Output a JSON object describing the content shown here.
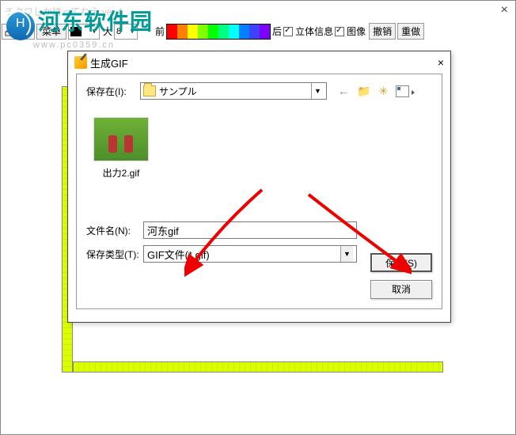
{
  "window": {
    "title": "チクワしか持ってねえ ver.4",
    "close": "×"
  },
  "watermark": {
    "text": "河东软件园",
    "url": "www.pc0359.cn"
  },
  "toolbar": {
    "menu": "菜单",
    "size_label": "大",
    "size_value": "8",
    "before": "前",
    "after": "后",
    "check1": "立体信息",
    "check2": "图像",
    "undo": "撤销",
    "redo": "重做"
  },
  "dialog": {
    "title": "生成GIF",
    "close": "×",
    "save_in_label": "保存在(I):",
    "folder": "サンプル",
    "thumb_name": "出力2.gif",
    "filename_label": "文件名(N):",
    "filename_value": "河东gif",
    "filetype_label": "保存类型(T):",
    "filetype_value": "GIF文件(*.gif)",
    "save_btn": "保存(S)",
    "cancel_btn": "取消"
  }
}
